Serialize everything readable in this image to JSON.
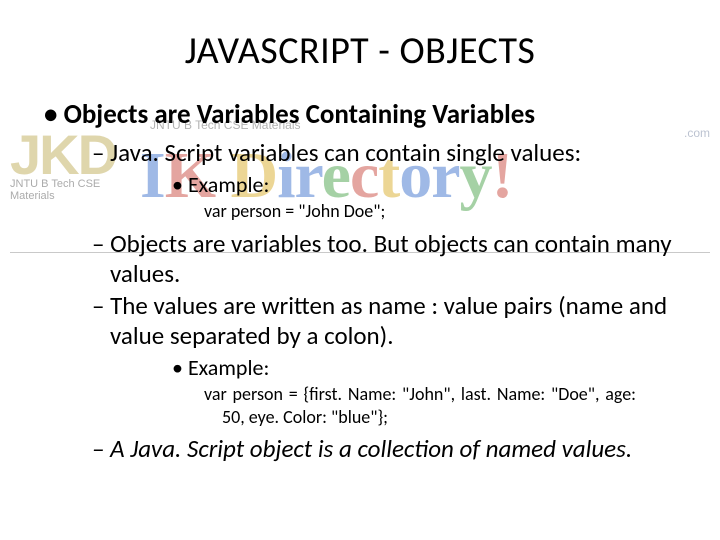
{
  "title": "JAVASCRIPT - OBJECTS",
  "bullets": {
    "l1": "Objects are Variables Containing Variables",
    "l2a": "Java. Script variables can contain single values:",
    "l3a": "Example:",
    "code1": "var person = \"John Doe\";",
    "l2b": "Objects are variables too. But objects can contain many values.",
    "l2c": "The values are written as name : value pairs (name and value separated by a colon).",
    "l3b": "Example:",
    "code2": "var person = {first. Name: \"John\", last. Name: \"Doe\", age: 50, eye. Color: \"blue\"};",
    "l2d": "A Java. Script object is a collection of named values."
  },
  "watermark": {
    "jkd": "JKD",
    "sub_top": "JNTU B Tech CSE Materials",
    "sub_diag": "JNTU B Tech CSE Materials",
    "ikd": "IK Directory!",
    "domain": ".com"
  }
}
